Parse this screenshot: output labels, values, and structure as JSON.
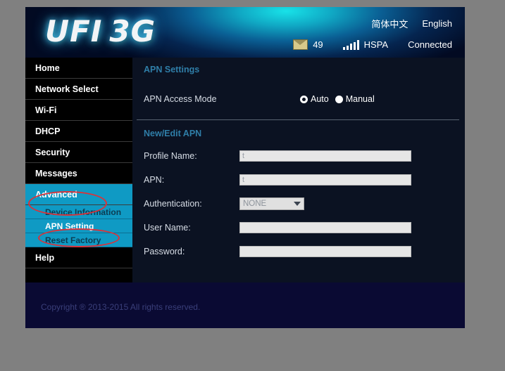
{
  "header": {
    "logo_primary": "UFI",
    "logo_secondary": "3G",
    "languages": [
      {
        "label": "简体中文",
        "name": "lang-chinese"
      },
      {
        "label": "English",
        "name": "lang-english"
      }
    ],
    "status": {
      "message_icon": "envelope-icon",
      "message_count": "49",
      "signal_icon": "signal-bars-icon",
      "network_type": "HSPA",
      "connection_state": "Connected"
    }
  },
  "sidebar": {
    "items": [
      {
        "label": "Home",
        "name": "sidebar-item-home",
        "active": false
      },
      {
        "label": "Network  Select",
        "name": "sidebar-item-network-select",
        "active": false
      },
      {
        "label": "Wi-Fi",
        "name": "sidebar-item-wifi",
        "active": false
      },
      {
        "label": "DHCP",
        "name": "sidebar-item-dhcp",
        "active": false
      },
      {
        "label": "Security",
        "name": "sidebar-item-security",
        "active": false
      },
      {
        "label": "Messages",
        "name": "sidebar-item-messages",
        "active": false
      },
      {
        "label": "Advanced",
        "name": "sidebar-item-advanced",
        "active": true
      }
    ],
    "sub_items": [
      {
        "label": "Device  Information",
        "name": "sidebar-subitem-device-information",
        "current": false
      },
      {
        "label": "APN  Setting",
        "name": "sidebar-subitem-apn-setting",
        "current": true
      },
      {
        "label": "Reset  Factory",
        "name": "sidebar-subitem-reset-factory",
        "current": false
      }
    ],
    "help_item": {
      "label": "Help",
      "name": "sidebar-item-help"
    }
  },
  "main": {
    "apn_settings": {
      "title": "APN Settings",
      "access_mode_label": "APN Access Mode",
      "options": [
        {
          "label": "Auto",
          "selected": true
        },
        {
          "label": "Manual",
          "selected": false
        }
      ]
    },
    "new_edit_apn": {
      "title": "New/Edit APN",
      "fields": [
        {
          "label": "Profile Name:",
          "value": "t",
          "type": "text",
          "name": "profile-name-input"
        },
        {
          "label": "APN:",
          "value": "t",
          "type": "text",
          "name": "apn-input"
        },
        {
          "label": "Authentication:",
          "value": "NONE",
          "type": "select",
          "name": "authentication-select"
        },
        {
          "label": "User Name:",
          "value": "",
          "type": "text",
          "name": "user-name-input"
        },
        {
          "label": "Password:",
          "value": "",
          "type": "text",
          "name": "password-input"
        }
      ]
    }
  },
  "footer": {
    "copyright": "Copyright ® 2013-2015  All  rights  reserved."
  },
  "annotations": {
    "accent_color": "#d9333a",
    "marks": [
      {
        "name": "annotation-ellipse-advanced",
        "target": "Advanced"
      },
      {
        "name": "annotation-ellipse-apn-setting",
        "target": "APN  Setting"
      }
    ]
  }
}
